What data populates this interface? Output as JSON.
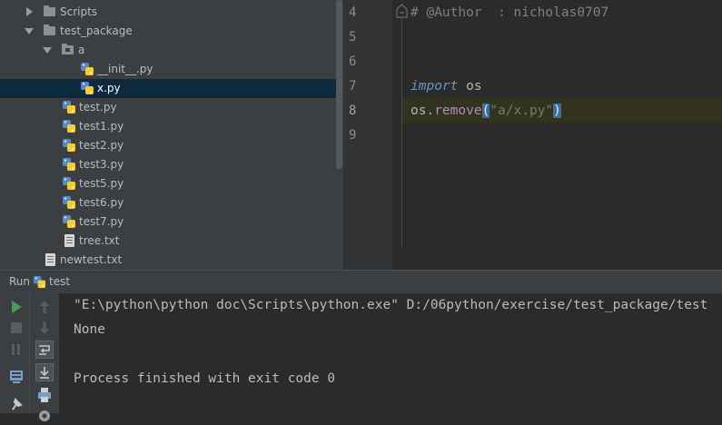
{
  "project_tree": {
    "items": [
      {
        "label": "Scripts",
        "kind": "folder",
        "expanded": false
      },
      {
        "label": "test_package",
        "kind": "folder",
        "expanded": true
      },
      {
        "label": "a",
        "kind": "package",
        "expanded": true
      },
      {
        "label": "__init__.py",
        "kind": "python-file"
      },
      {
        "label": "x.py",
        "kind": "python-file",
        "selected": true
      },
      {
        "label": "test.py",
        "kind": "python-file"
      },
      {
        "label": "test1.py",
        "kind": "python-file"
      },
      {
        "label": "test2.py",
        "kind": "python-file"
      },
      {
        "label": "test3.py",
        "kind": "python-file"
      },
      {
        "label": "test5.py",
        "kind": "python-file"
      },
      {
        "label": "test6.py",
        "kind": "python-file"
      },
      {
        "label": "test7.py",
        "kind": "python-file"
      },
      {
        "label": "tree.txt",
        "kind": "text-file"
      },
      {
        "label": "newtest.txt",
        "kind": "text-file"
      }
    ]
  },
  "editor": {
    "line_numbers": [
      "4",
      "5",
      "6",
      "7",
      "8",
      "9"
    ],
    "current_line": "8",
    "code": {
      "line4_comment": "# @Author  : nicholas0707",
      "line7_keyword": "import",
      "line7_module": " os",
      "line8_obj": "os.",
      "line8_func": "remove",
      "line8_open": "(",
      "line8_string": "\"a/x.py\"",
      "line8_close": ")"
    }
  },
  "run_panel": {
    "run_label": "Run",
    "config_name": "test",
    "console_lines": [
      "\"E:\\python\\python doc\\Scripts\\python.exe\" D:/06python/exercise/test_package/test",
      "None",
      "",
      "Process finished with exit code 0"
    ]
  },
  "colors": {
    "tree_bg": "#3c3f41",
    "editor_bg": "#2b2b2b",
    "selection": "#0d293e",
    "current_line": "#32321f",
    "keyword": "#6897bb",
    "string": "#6a8759",
    "function": "#b389c5",
    "comment": "#808080",
    "run_green": "#499c54"
  },
  "icons": [
    "expand-arrow-icon",
    "collapse-arrow-icon",
    "folder-icon",
    "package-icon",
    "python-file-icon",
    "text-file-icon",
    "run-icon",
    "stop-icon",
    "pause-icon",
    "rerun-icon",
    "scroll-up-icon",
    "scroll-down-icon",
    "soft-wrap-icon",
    "scroll-to-end-icon",
    "print-icon",
    "settings-icon",
    "pin-icon",
    "python-run-config-icon"
  ]
}
